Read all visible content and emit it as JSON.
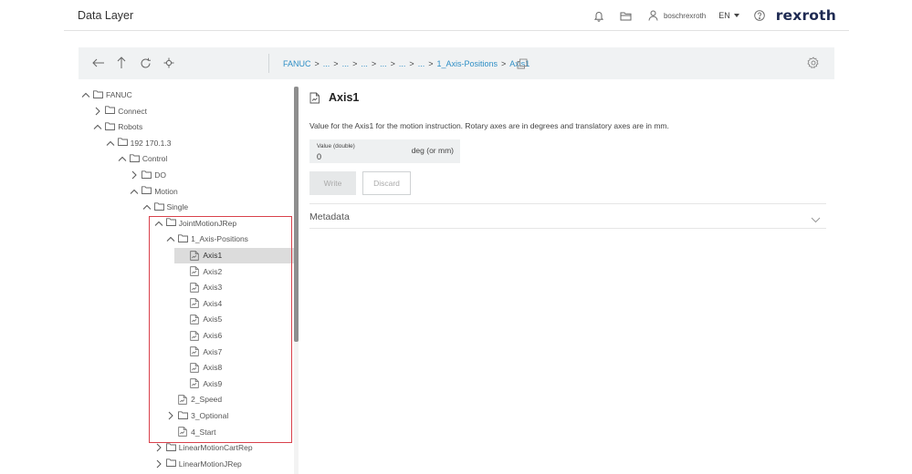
{
  "header": {
    "title": "Data Layer",
    "username": "boschrexroth",
    "language": "EN",
    "brand": "rexroth",
    "icons": [
      "bell-icon",
      "folder-open-icon",
      "user-icon",
      "chevron-down-icon",
      "help-icon"
    ]
  },
  "toolbar": {
    "icons": [
      "arrow-left-icon",
      "arrow-up-icon",
      "refresh-icon",
      "locate-icon"
    ],
    "breadcrumb": [
      "FANUC",
      "...",
      "...",
      "...",
      "...",
      "...",
      "...",
      "1_Axis-Positions",
      "Axis1"
    ],
    "separator": ">",
    "copy_icon": "copy-icon",
    "settings_icon": "gear-icon"
  },
  "tree": {
    "nodes": [
      {
        "label": "FANUC",
        "expander": "expanded",
        "icon": "folder"
      },
      {
        "label": "Connect",
        "expander": "collapsed",
        "icon": "folder"
      },
      {
        "label": "Robots",
        "expander": "expanded",
        "icon": "folder"
      },
      {
        "label": "192 170.1.3",
        "expander": "expanded",
        "icon": "folder"
      },
      {
        "label": "Control",
        "expander": "expanded",
        "icon": "folder"
      },
      {
        "label": "DO",
        "expander": "collapsed",
        "icon": "folder"
      },
      {
        "label": "Motion",
        "expander": "expanded",
        "icon": "folder"
      },
      {
        "label": "Single",
        "expander": "expanded",
        "icon": "folder"
      },
      {
        "label": "JointMotionJRep",
        "expander": "expanded",
        "icon": "folder"
      },
      {
        "label": "1_Axis-Positions",
        "expander": "expanded",
        "icon": "folder"
      },
      {
        "label": "Axis1",
        "expander": "none",
        "icon": "node",
        "selected": true
      },
      {
        "label": "Axis2",
        "expander": "none",
        "icon": "node"
      },
      {
        "label": "Axis3",
        "expander": "none",
        "icon": "node"
      },
      {
        "label": "Axis4",
        "expander": "none",
        "icon": "node"
      },
      {
        "label": "Axis5",
        "expander": "none",
        "icon": "node"
      },
      {
        "label": "Axis6",
        "expander": "none",
        "icon": "node"
      },
      {
        "label": "Axis7",
        "expander": "none",
        "icon": "node"
      },
      {
        "label": "Axis8",
        "expander": "none",
        "icon": "node"
      },
      {
        "label": "Axis9",
        "expander": "none",
        "icon": "node"
      },
      {
        "label": "2_Speed",
        "expander": "none",
        "icon": "node"
      },
      {
        "label": "3_Optional",
        "expander": "collapsed",
        "icon": "folder"
      },
      {
        "label": "4_Start",
        "expander": "none",
        "icon": "node"
      },
      {
        "label": "LinearMotionCartRep",
        "expander": "collapsed",
        "icon": "folder"
      },
      {
        "label": "LinearMotionJRep",
        "expander": "collapsed",
        "icon": "folder"
      }
    ]
  },
  "detail": {
    "title": "Axis1",
    "description": "Value for the Axis1 for the motion instruction. Rotary axes are in degrees and translatory axes are in mm.",
    "value_label": "Value (double)",
    "value": "0",
    "unit": "deg (or mm)",
    "write_label": "Write",
    "discard_label": "Discard",
    "metadata_label": "Metadata"
  },
  "colors": {
    "accent": "#2f8fc6",
    "brand": "#1e2a52",
    "highlight": "#d9414b",
    "toolbar_bg": "#f0f2f3",
    "selected_bg": "#dcdcdc"
  }
}
